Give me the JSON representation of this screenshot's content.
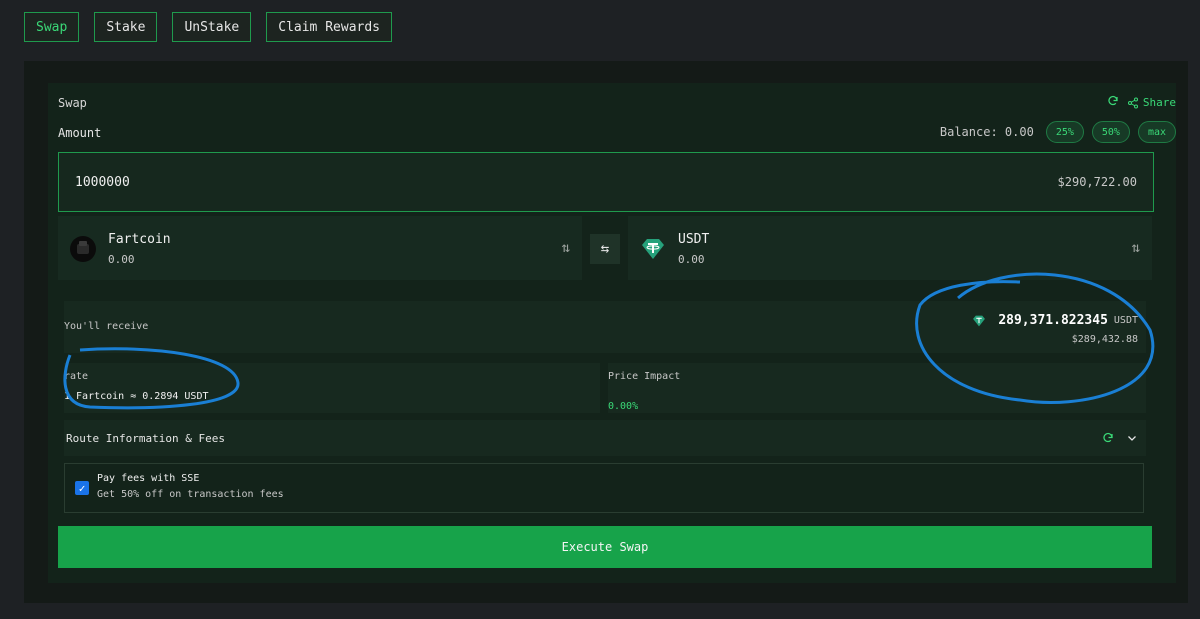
{
  "tabs": [
    {
      "label": "Swap",
      "active": true
    },
    {
      "label": "Stake",
      "active": false
    },
    {
      "label": "UnStake",
      "active": false
    },
    {
      "label": "Claim Rewards",
      "active": false
    }
  ],
  "swap": {
    "title": "Swap",
    "share_label": "Share",
    "amount_label": "Amount",
    "balance_label": "Balance:",
    "balance_value": "0.00",
    "pct_options": [
      "25%",
      "50%",
      "max"
    ],
    "amount_value": "1000000",
    "amount_usd": "$290,722.00",
    "from_token": {
      "name": "Fartcoin",
      "balance": "0.00"
    },
    "to_token": {
      "name": "USDT",
      "balance": "0.00"
    },
    "receive": {
      "label": "You'll receive",
      "amount": "289,371.822345",
      "unit": "USDT",
      "usd": "$289,432.88"
    },
    "rate": {
      "label": "rate",
      "value": "1 Fartcoin ≈ 0.2894 USDT"
    },
    "price_impact": {
      "label": "Price Impact",
      "value": "0.00%"
    },
    "route_label": "Route Information & Fees",
    "fees": {
      "title": "Pay fees with SSE",
      "subtitle": "Get 50% off on transaction fees",
      "checked": true
    },
    "execute_label": "Execute Swap"
  },
  "colors": {
    "accent": "#3ad877",
    "button": "#17a34a",
    "annotation": "#1a7fd4",
    "usdt": "#26a17b"
  }
}
